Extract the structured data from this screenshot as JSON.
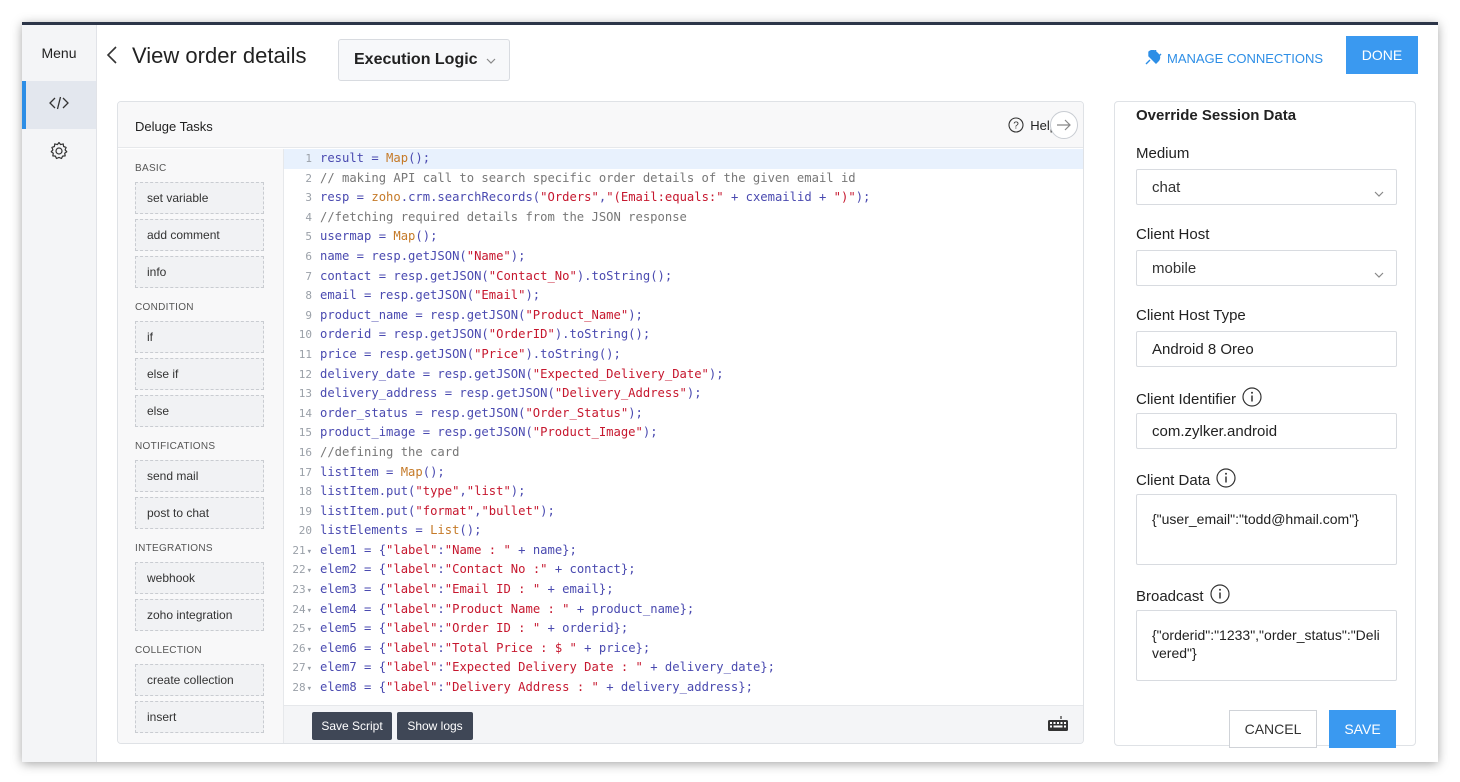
{
  "rail": {
    "menu_label": "Menu",
    "items": [
      {
        "icon": "code-icon",
        "active": true
      },
      {
        "icon": "gear-icon",
        "active": false
      }
    ]
  },
  "header": {
    "title": "View order details",
    "logic_select": "Execution Logic",
    "manage_connections": "MANAGE CONNECTIONS",
    "done_label": "DONE"
  },
  "tasks_panel": {
    "title": "Deluge Tasks",
    "help_label": "Help",
    "categories": [
      {
        "name": "BASIC",
        "items": [
          "set variable",
          "add comment",
          "info"
        ]
      },
      {
        "name": "CONDITION",
        "items": [
          "if",
          "else if",
          "else"
        ]
      },
      {
        "name": "NOTIFICATIONS",
        "items": [
          "send mail",
          "post to chat"
        ]
      },
      {
        "name": "INTEGRATIONS",
        "items": [
          "webhook",
          "zoho integration"
        ]
      },
      {
        "name": "COLLECTION",
        "items": [
          "create collection",
          "insert"
        ]
      }
    ]
  },
  "editor": {
    "lines": [
      [
        [
          "",
          "result = "
        ],
        [
          "c-fn",
          "Map"
        ],
        [
          "",
          "();"
        ]
      ],
      [
        [
          "c-comment",
          "// making API call to search specific order details of the given email id"
        ]
      ],
      [
        [
          "",
          "resp = "
        ],
        [
          "c-fn",
          "zoho"
        ],
        [
          "",
          ".crm.searchRecords("
        ],
        [
          "c-string",
          "\"Orders\""
        ],
        [
          "",
          ","
        ],
        [
          "c-string",
          "\"(Email:equals:\""
        ],
        [
          "",
          " + cxemailid + "
        ],
        [
          "c-string",
          "\")\""
        ],
        [
          "",
          ");"
        ]
      ],
      [
        [
          "c-comment",
          "//fetching required details from the JSON response"
        ]
      ],
      [
        [
          "",
          "usermap = "
        ],
        [
          "c-fn",
          "Map"
        ],
        [
          "",
          "();"
        ]
      ],
      [
        [
          "",
          "name = resp.getJSON("
        ],
        [
          "c-string",
          "\"Name\""
        ],
        [
          "",
          ");"
        ]
      ],
      [
        [
          "",
          "contact = resp.getJSON("
        ],
        [
          "c-string",
          "\"Contact_No\""
        ],
        [
          "",
          ").toString();"
        ]
      ],
      [
        [
          "",
          "email = resp.getJSON("
        ],
        [
          "c-string",
          "\"Email\""
        ],
        [
          "",
          ");"
        ]
      ],
      [
        [
          "",
          "product_name = resp.getJSON("
        ],
        [
          "c-string",
          "\"Product_Name\""
        ],
        [
          "",
          ");"
        ]
      ],
      [
        [
          "",
          "orderid = resp.getJSON("
        ],
        [
          "c-string",
          "\"OrderID\""
        ],
        [
          "",
          ").toString();"
        ]
      ],
      [
        [
          "",
          "price = resp.getJSON("
        ],
        [
          "c-string",
          "\"Price\""
        ],
        [
          "",
          ").toString();"
        ]
      ],
      [
        [
          "",
          "delivery_date = resp.getJSON("
        ],
        [
          "c-string",
          "\"Expected_Delivery_Date\""
        ],
        [
          "",
          ");"
        ]
      ],
      [
        [
          "",
          "delivery_address = resp.getJSON("
        ],
        [
          "c-string",
          "\"Delivery_Address\""
        ],
        [
          "",
          ");"
        ]
      ],
      [
        [
          "",
          "order_status = resp.getJSON("
        ],
        [
          "c-string",
          "\"Order_Status\""
        ],
        [
          "",
          ");"
        ]
      ],
      [
        [
          "",
          "product_image = resp.getJSON("
        ],
        [
          "c-string",
          "\"Product_Image\""
        ],
        [
          "",
          ");"
        ]
      ],
      [
        [
          "c-comment",
          "//defining the card"
        ]
      ],
      [
        [
          "",
          "listItem = "
        ],
        [
          "c-fn",
          "Map"
        ],
        [
          "",
          "();"
        ]
      ],
      [
        [
          "",
          "listItem.put("
        ],
        [
          "c-string",
          "\"type\""
        ],
        [
          "",
          ","
        ],
        [
          "c-string",
          "\"list\""
        ],
        [
          "",
          ");"
        ]
      ],
      [
        [
          "",
          "listItem.put("
        ],
        [
          "c-string",
          "\"format\""
        ],
        [
          "",
          ","
        ],
        [
          "c-string",
          "\"bullet\""
        ],
        [
          "",
          ");"
        ]
      ],
      [
        [
          "",
          "listElements = "
        ],
        [
          "c-fn",
          "List"
        ],
        [
          "",
          "();"
        ]
      ],
      [
        [
          "",
          "elem1 = {"
        ],
        [
          "c-string",
          "\"label\""
        ],
        [
          "",
          ":"
        ],
        [
          "c-string",
          "\"Name : \""
        ],
        [
          "",
          " + name};"
        ]
      ],
      [
        [
          "",
          "elem2 = {"
        ],
        [
          "c-string",
          "\"label\""
        ],
        [
          "",
          ":"
        ],
        [
          "c-string",
          "\"Contact No :\""
        ],
        [
          "",
          " + contact};"
        ]
      ],
      [
        [
          "",
          "elem3 = {"
        ],
        [
          "c-string",
          "\"label\""
        ],
        [
          "",
          ":"
        ],
        [
          "c-string",
          "\"Email ID : \""
        ],
        [
          "",
          " + email};"
        ]
      ],
      [
        [
          "",
          "elem4 = {"
        ],
        [
          "c-string",
          "\"label\""
        ],
        [
          "",
          ":"
        ],
        [
          "c-string",
          "\"Product Name : \""
        ],
        [
          "",
          " + product_name};"
        ]
      ],
      [
        [
          "",
          "elem5 = {"
        ],
        [
          "c-string",
          "\"label\""
        ],
        [
          "",
          ":"
        ],
        [
          "c-string",
          "\"Order ID : \""
        ],
        [
          "",
          " + orderid};"
        ]
      ],
      [
        [
          "",
          "elem6 = {"
        ],
        [
          "c-string",
          "\"label\""
        ],
        [
          "",
          ":"
        ],
        [
          "c-string",
          "\"Total Price : $ \""
        ],
        [
          "",
          " + price};"
        ]
      ],
      [
        [
          "",
          "elem7 = {"
        ],
        [
          "c-string",
          "\"label\""
        ],
        [
          "",
          ":"
        ],
        [
          "c-string",
          "\"Expected Delivery Date : \""
        ],
        [
          "",
          " + delivery_date};"
        ]
      ],
      [
        [
          "",
          "elem8 = {"
        ],
        [
          "c-string",
          "\"label\""
        ],
        [
          "",
          ":"
        ],
        [
          "c-string",
          "\"Delivery Address : \""
        ],
        [
          "",
          " + delivery_address};"
        ]
      ]
    ],
    "fold_from_line": 21,
    "save_script": "Save Script",
    "show_logs": "Show logs"
  },
  "session": {
    "title": "Override Session Data",
    "medium_label": "Medium",
    "medium_value": "chat",
    "client_host_label": "Client Host",
    "client_host_value": "mobile",
    "client_host_type_label": "Client Host Type",
    "client_host_type_value": "Android 8 Oreo",
    "client_identifier_label": "Client Identifier",
    "client_identifier_value": "com.zylker.android",
    "client_data_label": "Client Data",
    "client_data_value": "{\"user_email\":\"todd@hmail.com\"}",
    "broadcast_label": "Broadcast",
    "broadcast_value": "{\"orderid\":\"1233\",\"order_status\":\"Delivered\"}",
    "cancel_label": "CANCEL",
    "save_label": "SAVE"
  },
  "colors": {
    "accent": "#3a99f0",
    "dark_button": "#3f4756",
    "string": "#c6172e",
    "comment": "#777777"
  }
}
